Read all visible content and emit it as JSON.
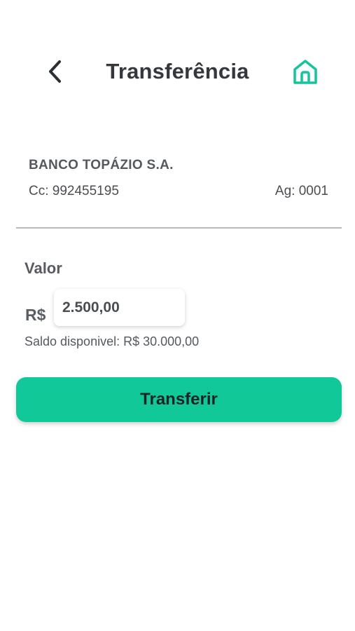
{
  "header": {
    "title": "Transferência",
    "back_icon": "chevron-left-icon",
    "home_icon": "home-icon"
  },
  "recipient": {
    "bank_name": "BANCO TOPÁZIO S.A.",
    "account": "Cc: 992455195",
    "agency": "Ag: 0001"
  },
  "amount": {
    "label": "Valor",
    "currency": "R$",
    "value": "2.500,00",
    "balance": "Saldo disponivel: R$ 30.000,00"
  },
  "actions": {
    "transfer_label": "Transferir"
  },
  "colors": {
    "accent": "#10c898",
    "icon_accent": "#14c49a",
    "text_dark": "#34383d"
  }
}
